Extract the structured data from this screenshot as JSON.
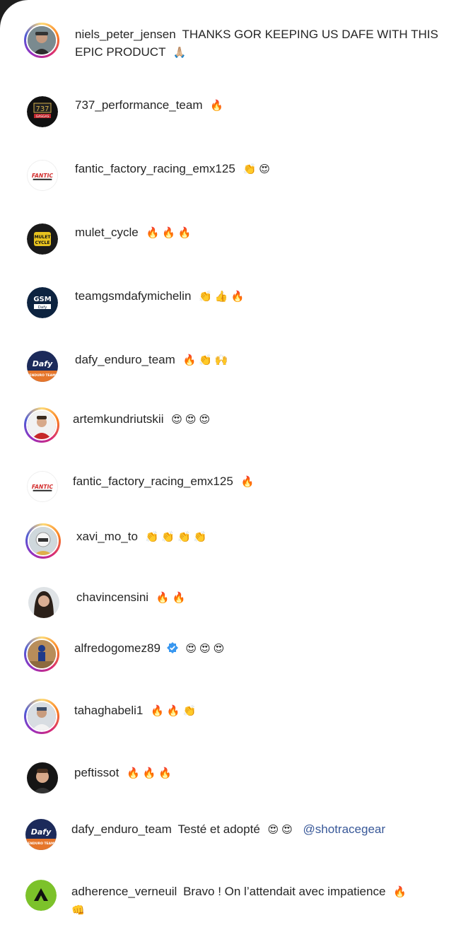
{
  "comments": [
    {
      "user": "niels_peter_jensen",
      "text": "THANKS GOR KEEPING US DAFE WITH THIS",
      "text2": "EPIC PRODUCT",
      "emoji": "🙏🏼",
      "emoji2": ""
    },
    {
      "user": "737_performance_team",
      "text": "",
      "emoji": "🔥"
    },
    {
      "user": "fantic_factory_racing_emx125",
      "text": "",
      "emoji": "👏😍"
    },
    {
      "user": "mulet_cycle",
      "text": "",
      "emoji": "🔥🔥🔥"
    },
    {
      "user": "teamgsmdafymichelin",
      "text": "",
      "emoji": "👏👍🔥"
    },
    {
      "user": "dafy_enduro_team",
      "text": "",
      "emoji": "🔥👏🙌"
    },
    {
      "user": "artemkundriutskii",
      "text": "",
      "emoji": "😍😍😍"
    },
    {
      "user": "fantic_factory_racing_emx125",
      "text": "",
      "emoji": "🔥"
    },
    {
      "user": "xavi_mo_to",
      "text": "",
      "emoji": "👏👏👏👏"
    },
    {
      "user": "chavincensini",
      "text": "",
      "emoji": "🔥🔥"
    },
    {
      "user": "alfredogomez89",
      "text": "",
      "emoji": "😍😍😍",
      "verified": true
    },
    {
      "user": "tahaghabeli1",
      "text": "",
      "emoji": "🔥🔥👏"
    },
    {
      "user": "peftissot",
      "text": "",
      "emoji": "🔥🔥🔥"
    },
    {
      "user": "dafy_enduro_team",
      "text": "Testé et adopté",
      "emoji": "😍😍",
      "mention": "@shotracegear"
    },
    {
      "user": "adherence_verneuil",
      "text": "Bravo ! On l’attendait avec impatience",
      "emoji": "🔥",
      "emoji2": "👊"
    }
  ],
  "avatars": {
    "737_logo_text": "737",
    "gasgas_text": "GASGAS",
    "fantic_text": "FANTIC",
    "mulet_text": "MULET CYCLE",
    "gsm_text": "GSM",
    "dafy_text": "Dafy",
    "dafy_sub": "ENDURO TEAM"
  },
  "colors": {
    "background": "#1e1e1e",
    "panel": "#ffffff",
    "text": "#262626",
    "mention": "#385898",
    "verified": "#3897f0"
  }
}
